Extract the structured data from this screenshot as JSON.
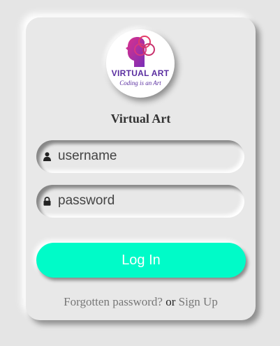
{
  "logo": {
    "title": "VIRTUAL ART",
    "tagline": "Coding is an Art",
    "icon": "head-with-circles-icon"
  },
  "brand_name": "Virtual Art",
  "login_form": {
    "username": {
      "placeholder": "username",
      "value": "",
      "icon": "user-icon"
    },
    "password": {
      "placeholder": "password",
      "value": "",
      "icon": "lock-icon"
    },
    "submit_label": "Log In"
  },
  "footer": {
    "forgot_label": "Forgotten password?",
    "or_text": "or",
    "signup_label": "Sign Up"
  },
  "colors": {
    "background": "#e5e5e5",
    "card": "#e8e8e8",
    "button": "#00fbc8",
    "button_text": "#ffffff",
    "logo_text": "#5a2ea0"
  }
}
